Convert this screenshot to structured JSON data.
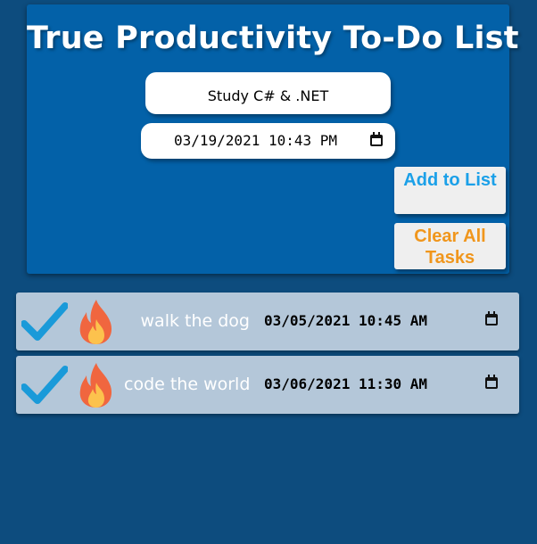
{
  "header": {
    "title": "True Productivity To-Do List"
  },
  "form": {
    "task_input_value": "Study C# & .NET",
    "date_input_value": "03/19/2021 10:43 PM",
    "add_button_label": "Add to List",
    "clear_button_label": "Clear All Tasks"
  },
  "tasks": [
    {
      "name": "walk the dog",
      "datetime": "03/05/2021 10:45 AM",
      "icons": [
        "check-icon",
        "fire-icon",
        "calendar-icon"
      ]
    },
    {
      "name": "code the world",
      "datetime": "03/06/2021 11:30 AM",
      "icons": [
        "check-icon",
        "fire-icon",
        "calendar-icon"
      ]
    }
  ],
  "colors": {
    "page_background": "#0d4c7e",
    "form_background": "#0361a8",
    "task_background": "#b4c7d9",
    "check_icon": "#1a9ad9",
    "add_button_text": "#1ba0e8",
    "clear_button_text": "#f0961c"
  }
}
